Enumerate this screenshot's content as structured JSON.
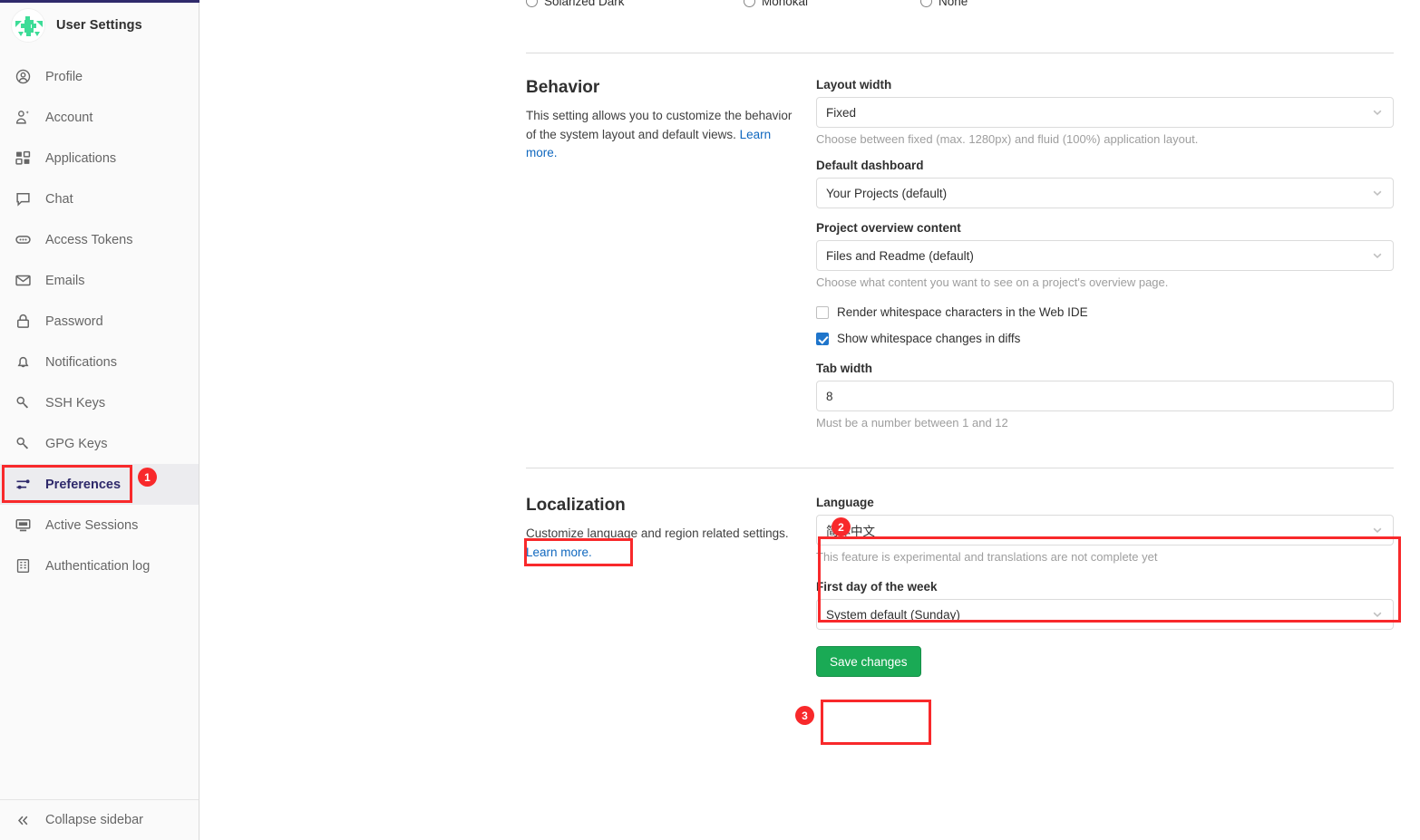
{
  "sidebar": {
    "brand": {
      "title": "User Settings",
      "avatar_icon": "identicon-avatar"
    },
    "items": [
      {
        "label": "Profile",
        "icon": "user-circle-icon",
        "active": false
      },
      {
        "label": "Account",
        "icon": "account-gear-icon",
        "active": false
      },
      {
        "label": "Applications",
        "icon": "applications-icon",
        "active": false
      },
      {
        "label": "Chat",
        "icon": "chat-icon",
        "active": false
      },
      {
        "label": "Access Tokens",
        "icon": "token-icon",
        "active": false
      },
      {
        "label": "Emails",
        "icon": "envelope-icon",
        "active": false
      },
      {
        "label": "Password",
        "icon": "lock-icon",
        "active": false
      },
      {
        "label": "Notifications",
        "icon": "bell-icon",
        "active": false
      },
      {
        "label": "SSH Keys",
        "icon": "key-icon",
        "active": false
      },
      {
        "label": "GPG Keys",
        "icon": "key-icon",
        "active": false
      },
      {
        "label": "Preferences",
        "icon": "sliders-icon",
        "active": true
      },
      {
        "label": "Active Sessions",
        "icon": "monitor-icon",
        "active": false
      },
      {
        "label": "Authentication log",
        "icon": "log-list-icon",
        "active": false
      }
    ],
    "collapse": {
      "label": "Collapse sidebar",
      "icon": "chevron-double-left-icon"
    }
  },
  "syntax_theme_radios": [
    {
      "label": "Solarized Dark",
      "selected": false
    },
    {
      "label": "Monokai",
      "selected": false
    },
    {
      "label": "None",
      "selected": false
    }
  ],
  "behavior": {
    "title": "Behavior",
    "description": "This setting allows you to customize the behavior of the system layout and default views.",
    "learn_more": "Learn more.",
    "layout_width": {
      "label": "Layout width",
      "value": "Fixed",
      "help": "Choose between fixed (max. 1280px) and fluid (100%) application layout."
    },
    "default_dashboard": {
      "label": "Default dashboard",
      "value": "Your Projects (default)"
    },
    "project_overview": {
      "label": "Project overview content",
      "value": "Files and Readme (default)",
      "help": "Choose what content you want to see on a project's overview page."
    },
    "render_whitespace": {
      "label": "Render whitespace characters in the Web IDE",
      "checked": false
    },
    "show_whitespace_diffs": {
      "label": "Show whitespace changes in diffs",
      "checked": true
    },
    "tab_width": {
      "label": "Tab width",
      "value": "8",
      "help": "Must be a number between 1 and 12"
    }
  },
  "localization": {
    "title": "Localization",
    "description": "Customize language and region related settings.",
    "learn_more": "Learn more.",
    "language": {
      "label": "Language",
      "value": "简体中文",
      "help": "This feature is experimental and translations are not complete yet"
    },
    "first_day": {
      "label": "First day of the week",
      "value": "System default (Sunday)"
    },
    "save_button": "Save changes"
  },
  "annotations": {
    "badge1": "1",
    "badge2": "2",
    "badge3": "3"
  },
  "colors": {
    "accent_brand": "#2f2a6b",
    "link": "#1068bf",
    "save_green": "#1aaa55",
    "annotation_red": "#f8292b",
    "checkbox_blue": "#1f75cb"
  }
}
